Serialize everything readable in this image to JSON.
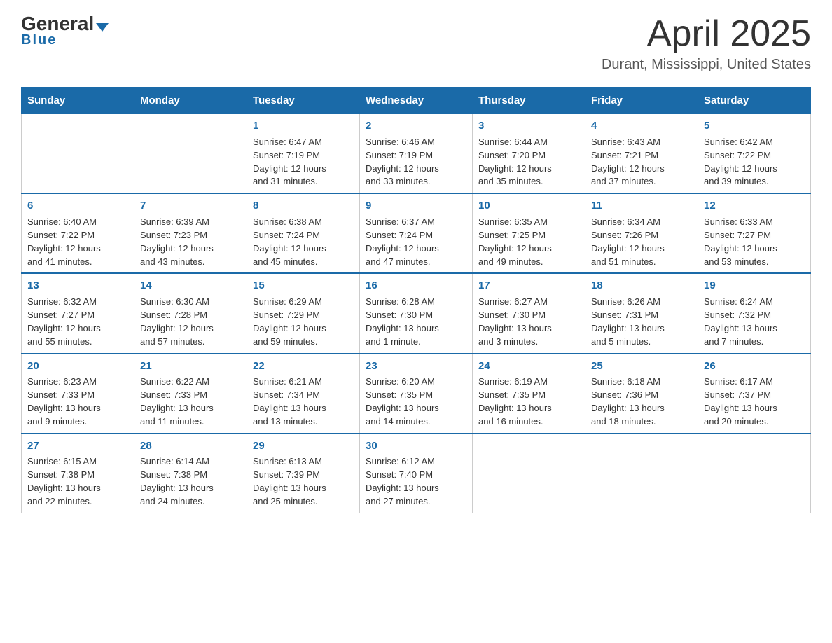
{
  "logo": {
    "general": "General",
    "arrow": "▼",
    "blue": "Blue"
  },
  "title": "April 2025",
  "subtitle": "Durant, Mississippi, United States",
  "days": [
    "Sunday",
    "Monday",
    "Tuesday",
    "Wednesday",
    "Thursday",
    "Friday",
    "Saturday"
  ],
  "weeks": [
    [
      {
        "day": "",
        "lines": []
      },
      {
        "day": "",
        "lines": []
      },
      {
        "day": "1",
        "lines": [
          "Sunrise: 6:47 AM",
          "Sunset: 7:19 PM",
          "Daylight: 12 hours",
          "and 31 minutes."
        ]
      },
      {
        "day": "2",
        "lines": [
          "Sunrise: 6:46 AM",
          "Sunset: 7:19 PM",
          "Daylight: 12 hours",
          "and 33 minutes."
        ]
      },
      {
        "day": "3",
        "lines": [
          "Sunrise: 6:44 AM",
          "Sunset: 7:20 PM",
          "Daylight: 12 hours",
          "and 35 minutes."
        ]
      },
      {
        "day": "4",
        "lines": [
          "Sunrise: 6:43 AM",
          "Sunset: 7:21 PM",
          "Daylight: 12 hours",
          "and 37 minutes."
        ]
      },
      {
        "day": "5",
        "lines": [
          "Sunrise: 6:42 AM",
          "Sunset: 7:22 PM",
          "Daylight: 12 hours",
          "and 39 minutes."
        ]
      }
    ],
    [
      {
        "day": "6",
        "lines": [
          "Sunrise: 6:40 AM",
          "Sunset: 7:22 PM",
          "Daylight: 12 hours",
          "and 41 minutes."
        ]
      },
      {
        "day": "7",
        "lines": [
          "Sunrise: 6:39 AM",
          "Sunset: 7:23 PM",
          "Daylight: 12 hours",
          "and 43 minutes."
        ]
      },
      {
        "day": "8",
        "lines": [
          "Sunrise: 6:38 AM",
          "Sunset: 7:24 PM",
          "Daylight: 12 hours",
          "and 45 minutes."
        ]
      },
      {
        "day": "9",
        "lines": [
          "Sunrise: 6:37 AM",
          "Sunset: 7:24 PM",
          "Daylight: 12 hours",
          "and 47 minutes."
        ]
      },
      {
        "day": "10",
        "lines": [
          "Sunrise: 6:35 AM",
          "Sunset: 7:25 PM",
          "Daylight: 12 hours",
          "and 49 minutes."
        ]
      },
      {
        "day": "11",
        "lines": [
          "Sunrise: 6:34 AM",
          "Sunset: 7:26 PM",
          "Daylight: 12 hours",
          "and 51 minutes."
        ]
      },
      {
        "day": "12",
        "lines": [
          "Sunrise: 6:33 AM",
          "Sunset: 7:27 PM",
          "Daylight: 12 hours",
          "and 53 minutes."
        ]
      }
    ],
    [
      {
        "day": "13",
        "lines": [
          "Sunrise: 6:32 AM",
          "Sunset: 7:27 PM",
          "Daylight: 12 hours",
          "and 55 minutes."
        ]
      },
      {
        "day": "14",
        "lines": [
          "Sunrise: 6:30 AM",
          "Sunset: 7:28 PM",
          "Daylight: 12 hours",
          "and 57 minutes."
        ]
      },
      {
        "day": "15",
        "lines": [
          "Sunrise: 6:29 AM",
          "Sunset: 7:29 PM",
          "Daylight: 12 hours",
          "and 59 minutes."
        ]
      },
      {
        "day": "16",
        "lines": [
          "Sunrise: 6:28 AM",
          "Sunset: 7:30 PM",
          "Daylight: 13 hours",
          "and 1 minute."
        ]
      },
      {
        "day": "17",
        "lines": [
          "Sunrise: 6:27 AM",
          "Sunset: 7:30 PM",
          "Daylight: 13 hours",
          "and 3 minutes."
        ]
      },
      {
        "day": "18",
        "lines": [
          "Sunrise: 6:26 AM",
          "Sunset: 7:31 PM",
          "Daylight: 13 hours",
          "and 5 minutes."
        ]
      },
      {
        "day": "19",
        "lines": [
          "Sunrise: 6:24 AM",
          "Sunset: 7:32 PM",
          "Daylight: 13 hours",
          "and 7 minutes."
        ]
      }
    ],
    [
      {
        "day": "20",
        "lines": [
          "Sunrise: 6:23 AM",
          "Sunset: 7:33 PM",
          "Daylight: 13 hours",
          "and 9 minutes."
        ]
      },
      {
        "day": "21",
        "lines": [
          "Sunrise: 6:22 AM",
          "Sunset: 7:33 PM",
          "Daylight: 13 hours",
          "and 11 minutes."
        ]
      },
      {
        "day": "22",
        "lines": [
          "Sunrise: 6:21 AM",
          "Sunset: 7:34 PM",
          "Daylight: 13 hours",
          "and 13 minutes."
        ]
      },
      {
        "day": "23",
        "lines": [
          "Sunrise: 6:20 AM",
          "Sunset: 7:35 PM",
          "Daylight: 13 hours",
          "and 14 minutes."
        ]
      },
      {
        "day": "24",
        "lines": [
          "Sunrise: 6:19 AM",
          "Sunset: 7:35 PM",
          "Daylight: 13 hours",
          "and 16 minutes."
        ]
      },
      {
        "day": "25",
        "lines": [
          "Sunrise: 6:18 AM",
          "Sunset: 7:36 PM",
          "Daylight: 13 hours",
          "and 18 minutes."
        ]
      },
      {
        "day": "26",
        "lines": [
          "Sunrise: 6:17 AM",
          "Sunset: 7:37 PM",
          "Daylight: 13 hours",
          "and 20 minutes."
        ]
      }
    ],
    [
      {
        "day": "27",
        "lines": [
          "Sunrise: 6:15 AM",
          "Sunset: 7:38 PM",
          "Daylight: 13 hours",
          "and 22 minutes."
        ]
      },
      {
        "day": "28",
        "lines": [
          "Sunrise: 6:14 AM",
          "Sunset: 7:38 PM",
          "Daylight: 13 hours",
          "and 24 minutes."
        ]
      },
      {
        "day": "29",
        "lines": [
          "Sunrise: 6:13 AM",
          "Sunset: 7:39 PM",
          "Daylight: 13 hours",
          "and 25 minutes."
        ]
      },
      {
        "day": "30",
        "lines": [
          "Sunrise: 6:12 AM",
          "Sunset: 7:40 PM",
          "Daylight: 13 hours",
          "and 27 minutes."
        ]
      },
      {
        "day": "",
        "lines": []
      },
      {
        "day": "",
        "lines": []
      },
      {
        "day": "",
        "lines": []
      }
    ]
  ]
}
